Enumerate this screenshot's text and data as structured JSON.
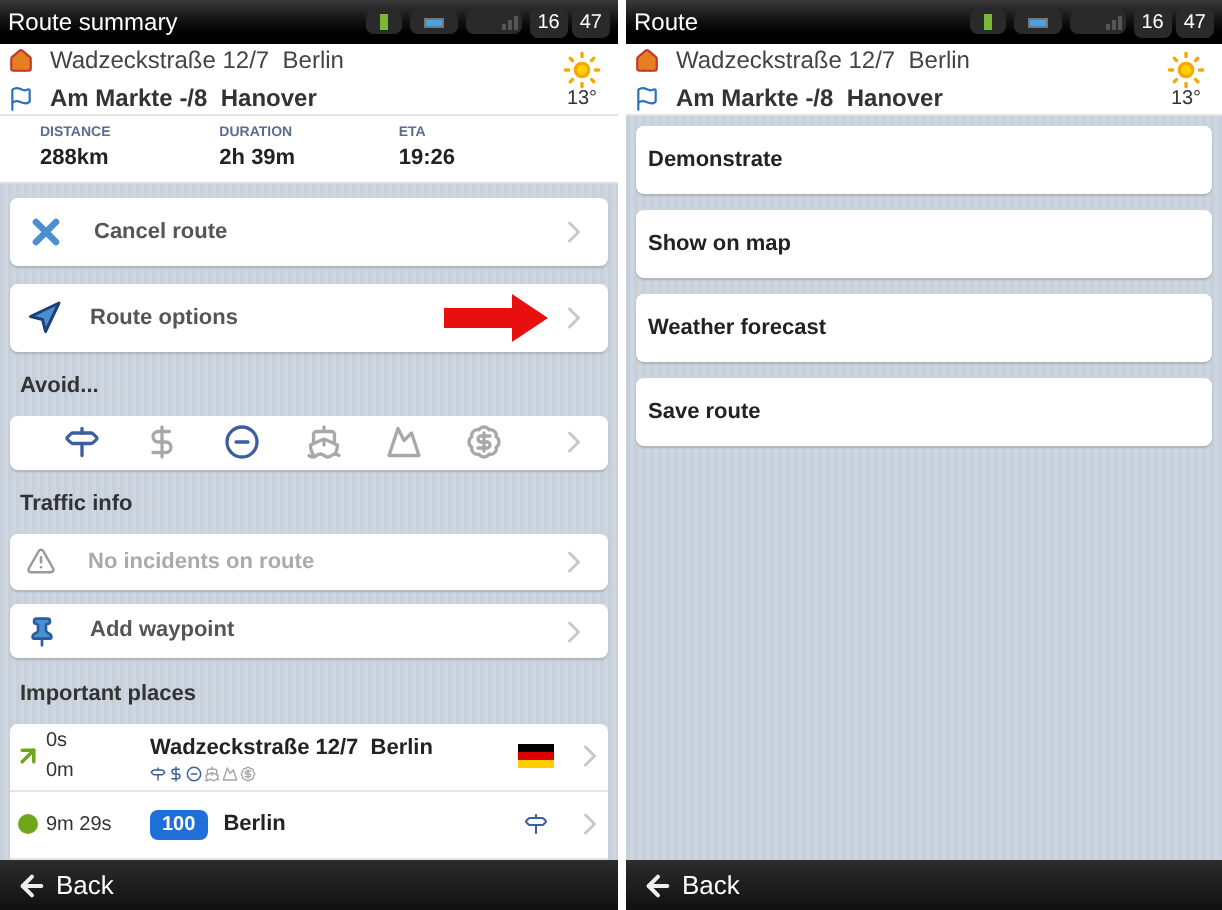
{
  "summary_screen": {
    "status_bar": {
      "title": "Route summary",
      "hour": "16",
      "minute": "47"
    },
    "route": {
      "start": "Wadzeckstraße 12/7  Berlin",
      "destination": "Am Markte -/8  Hanover",
      "temperature": "13°"
    },
    "stats": [
      {
        "label": "DISTANCE",
        "value": "288km"
      },
      {
        "label": "DURATION",
        "value": "2h 39m"
      },
      {
        "label": "ETA",
        "value": "19:26"
      }
    ],
    "actions": [
      {
        "kind": "cancel",
        "label": "Cancel route",
        "highlighted": false
      },
      {
        "kind": "options",
        "label": "Route options",
        "highlighted": true
      }
    ],
    "avoid": {
      "heading": "Avoid...",
      "items": [
        {
          "kind": "highway",
          "active": true
        },
        {
          "kind": "toll",
          "active": false
        },
        {
          "kind": "restricted",
          "active": true
        },
        {
          "kind": "ferry",
          "active": false
        },
        {
          "kind": "unpaved",
          "active": false
        },
        {
          "kind": "vignette",
          "active": false
        }
      ]
    },
    "traffic": {
      "heading": "Traffic info",
      "message": "No incidents on route"
    },
    "waypoint": {
      "label": "Add waypoint"
    },
    "places": {
      "heading": "Important places",
      "rows": [
        {
          "time": "0s",
          "distance": "0m",
          "name": "Wadzeckstraße 12/7  Berlin",
          "avoid": [
            {
              "kind": "highway",
              "active": true
            },
            {
              "kind": "toll",
              "active": true
            },
            {
              "kind": "restricted",
              "active": true
            },
            {
              "kind": "ferry",
              "active": false
            },
            {
              "kind": "unpaved",
              "active": false
            },
            {
              "kind": "vignette",
              "active": false
            }
          ],
          "kind": "flag"
        },
        {
          "time": "9m 29s",
          "road": "100",
          "name": "Berlin",
          "kind": "highway"
        }
      ]
    },
    "back": "Back"
  },
  "route_menu_screen": {
    "status_bar": {
      "title": "Route",
      "hour": "16",
      "minute": "47"
    },
    "route": {
      "start": "Wadzeckstraße 12/7  Berlin",
      "destination": "Am Markte -/8  Hanover",
      "temperature": "13°"
    },
    "menu": [
      "Demonstrate",
      "Show on map",
      "Weather forecast",
      "Save route"
    ],
    "back": "Back"
  }
}
